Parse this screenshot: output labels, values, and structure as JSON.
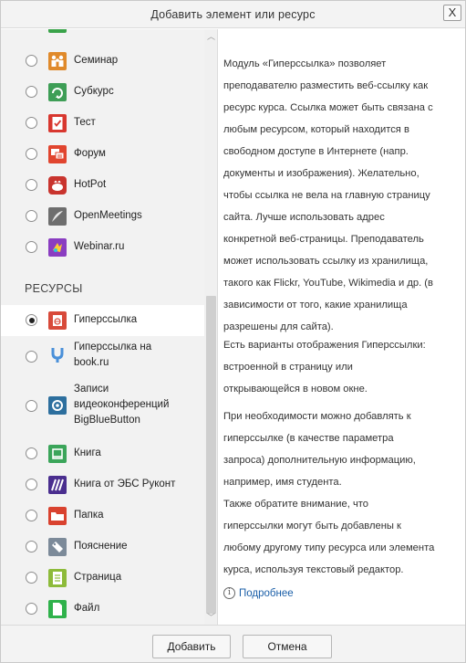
{
  "dialog": {
    "title": "Добавить элемент или ресурс",
    "close_label": "X"
  },
  "activities": [
    {
      "label": "Семинар",
      "icon": "workshop-icon"
    },
    {
      "label": "Субкурс",
      "icon": "subcourse-icon"
    },
    {
      "label": "Тест",
      "icon": "quiz-icon"
    },
    {
      "label": "Форум",
      "icon": "forum-icon"
    },
    {
      "label": "HotPot",
      "icon": "hotpot-icon"
    },
    {
      "label": "OpenMeetings",
      "icon": "openmeetings-icon"
    },
    {
      "label": "Webinar.ru",
      "icon": "webinar-icon"
    }
  ],
  "resources_heading": "РЕСУРСЫ",
  "resources": [
    {
      "label": "Гиперссылка",
      "icon": "url-icon",
      "selected": true
    },
    {
      "label": "Гиперссылка на\nbook.ru",
      "line1": "Гиперссылка на",
      "line2": "book.ru",
      "icon": "bookru-icon"
    },
    {
      "line1": "Записи",
      "line2": "видеоконференций",
      "line3": "BigBlueButton",
      "icon": "bbb-recordings-icon"
    },
    {
      "label": "Книга",
      "icon": "book-icon"
    },
    {
      "label": "Книга от ЭБС Руконт",
      "icon": "rucont-icon"
    },
    {
      "label": "Папка",
      "icon": "folder-icon"
    },
    {
      "label": "Пояснение",
      "icon": "label-icon"
    },
    {
      "label": "Страница",
      "icon": "page-icon"
    },
    {
      "label": "Файл",
      "icon": "file-icon"
    }
  ],
  "description": {
    "p1": [
      "Модуль «Гиперссылка» позволяет",
      "преподавателю разместить веб-ссылку как",
      "ресурс курса. Ссылка может быть связана с",
      "любым ресурсом, который находится в",
      "свободном доступе в Интернете (напр.",
      "документы и изображения). Желательно,",
      "чтобы ссылка не вела на главную страницу",
      "сайта. Лучше использовать адрес",
      "конкретной веб-страницы. Преподаватель",
      "может использовать ссылку из хранилища,",
      "такого как Flickr, YouTube, Wikimedia и др. (в",
      "зависимости от того, какие хранилища",
      "разрешены для сайта)."
    ],
    "p2": [
      "Есть варианты отображения Гиперссылки:",
      "встроенной в страницу или",
      "открывающейся в новом окне."
    ],
    "p3": [
      "При необходимости можно добавлять к",
      "гиперссылке (в качестве параметра",
      "запроса) дополнительную информацию,",
      "например, имя студента."
    ],
    "p4": [
      "Также обратите внимание, что",
      "гиперссылки могут быть добавлены к",
      "любому другому типу ресурса или элемента",
      "курса, используя текстовый редактор."
    ],
    "more_link": "Подробнее"
  },
  "footer": {
    "add_label": "Добавить",
    "cancel_label": "Отмена"
  },
  "colors": {
    "link": "#1b5fa8",
    "panel_bg": "#f2f2f2",
    "selected_bg": "#ffffff"
  }
}
